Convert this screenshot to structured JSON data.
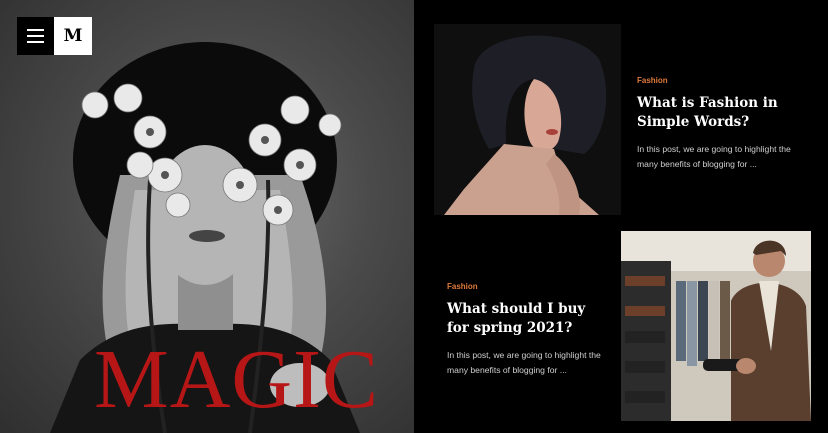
{
  "header": {
    "menu_icon": "hamburger-icon",
    "logo_letter": "M"
  },
  "hero": {
    "headline": "MAGIC",
    "headline_color": "#b71616"
  },
  "posts": [
    {
      "category": "Fashion",
      "title": "What is Fashion in Simple Words?",
      "excerpt": "In this post, we are going to highlight the many benefits of blogging for ..."
    },
    {
      "category": "Fashion",
      "title": "What should I buy for spring 2021?",
      "excerpt": "In this post, we are going to highlight the many benefits of blogging for ..."
    }
  ],
  "colors": {
    "accent": "#e07a3a",
    "background": "#000000"
  }
}
